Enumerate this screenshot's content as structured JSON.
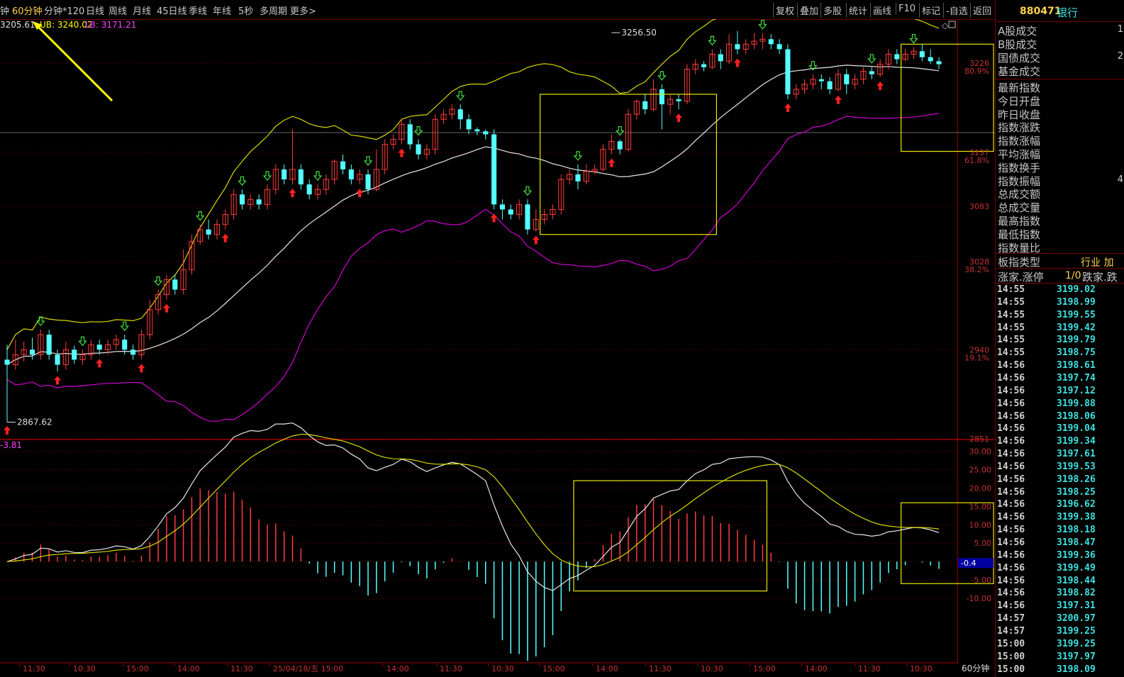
{
  "toolbar": {
    "periods": [
      "钟",
      "60分钟",
      "分钟*120",
      "日线",
      "周线",
      "月线",
      "45日线",
      "季线",
      "年线",
      "5秒",
      "多周期",
      "更多>"
    ],
    "active_index": 1,
    "right_buttons": [
      "复权",
      "叠加",
      "多股",
      "统计",
      "画线",
      "F10",
      "标记",
      "-自选",
      "返回"
    ]
  },
  "indicator": {
    "mid_text": "3205.61",
    "ub_text": "UB: 3240.02",
    "lb_text": "LB: 3171.21",
    "macd_text": "-3.81"
  },
  "main_axis": {
    "labels": [
      {
        "v": 3226,
        "t": "3226",
        "pct": "80.9%"
      },
      {
        "v": 3137,
        "t": "3137",
        "pct": "61.8%"
      },
      {
        "v": 3083,
        "t": "3083",
        "pct": ""
      },
      {
        "v": 3028,
        "t": "3028",
        "pct": "38.2%"
      },
      {
        "v": 2940,
        "t": "2940",
        "pct": "19.1%"
      },
      {
        "v": 2851,
        "t": "2851",
        "pct": ""
      }
    ],
    "annotations": [
      {
        "text": "2867.62",
        "v": 2867.62,
        "i": 0
      },
      {
        "text": "3256.50",
        "v": 3256.5,
        "i": 72
      }
    ]
  },
  "sub_axis": {
    "labels": [
      "30.00",
      "25.00",
      "20.00",
      "15.00",
      "10.00",
      "5.00",
      "-5.00",
      "-10.00"
    ],
    "current": "-0.4"
  },
  "x_axis": {
    "labels": [
      "11:30",
      "10:30",
      "15:00",
      "14:00",
      "11:30",
      "25/04/18/五 15:00",
      "14:00",
      "11:30",
      "10:30",
      "15:00",
      "14:00",
      "11:30",
      "10:30",
      "15:00",
      "14:00",
      "11:30",
      "10:30"
    ],
    "period": "60分钟"
  },
  "chart_data": {
    "type": "candlestick",
    "ylim": [
      2851,
      3270
    ],
    "subplot": {
      "type": "macd",
      "ylim": [
        -26,
        33
      ]
    },
    "candles": [
      [
        2930,
        2925,
        2945,
        2868
      ],
      [
        2925,
        2935,
        2950,
        2920
      ],
      [
        2935,
        2940,
        2948,
        2928
      ],
      [
        2940,
        2935,
        2952,
        2930
      ],
      [
        2935,
        2955,
        2960,
        2930
      ],
      [
        2955,
        2935,
        2960,
        2930
      ],
      [
        2935,
        2925,
        2940,
        2918
      ],
      [
        2925,
        2940,
        2948,
        2920
      ],
      [
        2940,
        2930,
        2944,
        2926
      ],
      [
        2930,
        2935,
        2940,
        2925
      ],
      [
        2935,
        2945,
        2950,
        2930
      ],
      [
        2945,
        2940,
        2950,
        2935
      ],
      [
        2940,
        2945,
        2950,
        2935
      ],
      [
        2945,
        2950,
        2955,
        2940
      ],
      [
        2950,
        2940,
        2955,
        2935
      ],
      [
        2940,
        2935,
        2945,
        2930
      ],
      [
        2935,
        2955,
        2960,
        2930
      ],
      [
        2955,
        2980,
        2990,
        2950
      ],
      [
        2980,
        2995,
        3000,
        2975
      ],
      [
        2995,
        3010,
        3015,
        2990
      ],
      [
        3010,
        3000,
        3015,
        2995
      ],
      [
        3000,
        3020,
        3040,
        2995
      ],
      [
        3020,
        3048,
        3055,
        3015
      ],
      [
        3048,
        3060,
        3065,
        3045
      ],
      [
        3060,
        3055,
        3070,
        3050
      ],
      [
        3055,
        3065,
        3070,
        3050
      ],
      [
        3065,
        3075,
        3080,
        3060
      ],
      [
        3075,
        3095,
        3100,
        3070
      ],
      [
        3095,
        3085,
        3100,
        3080
      ],
      [
        3085,
        3090,
        3095,
        3080
      ],
      [
        3090,
        3085,
        3095,
        3080
      ],
      [
        3085,
        3100,
        3105,
        3080
      ],
      [
        3100,
        3120,
        3125,
        3095
      ],
      [
        3120,
        3110,
        3125,
        3105
      ],
      [
        3110,
        3120,
        3160,
        3105
      ],
      [
        3120,
        3105,
        3125,
        3100
      ],
      [
        3105,
        3095,
        3110,
        3090
      ],
      [
        3095,
        3100,
        3105,
        3090
      ],
      [
        3100,
        3110,
        3115,
        3095
      ],
      [
        3110,
        3128,
        3130,
        3105
      ],
      [
        3128,
        3120,
        3135,
        3115
      ],
      [
        3120,
        3110,
        3125,
        3105
      ],
      [
        3110,
        3115,
        3120,
        3105
      ],
      [
        3115,
        3100,
        3120,
        3095
      ],
      [
        3100,
        3120,
        3140,
        3098
      ],
      [
        3120,
        3145,
        3150,
        3115
      ],
      [
        3145,
        3150,
        3155,
        3140
      ],
      [
        3150,
        3165,
        3170,
        3145
      ],
      [
        3165,
        3145,
        3170,
        3140
      ],
      [
        3145,
        3135,
        3150,
        3130
      ],
      [
        3135,
        3140,
        3145,
        3130
      ],
      [
        3140,
        3170,
        3175,
        3135
      ],
      [
        3170,
        3175,
        3180,
        3165
      ],
      [
        3175,
        3180,
        3185,
        3170
      ],
      [
        3180,
        3170,
        3185,
        3160
      ],
      [
        3170,
        3160,
        3175,
        3155
      ],
      [
        3160,
        3158,
        3162,
        3154
      ],
      [
        3158,
        3155,
        3160,
        3150
      ],
      [
        3155,
        3085,
        3160,
        3080
      ],
      [
        3085,
        3080,
        3090,
        3070
      ],
      [
        3080,
        3075,
        3085,
        3070
      ],
      [
        3075,
        3085,
        3090,
        3070
      ],
      [
        3085,
        3060,
        3090,
        3055
      ],
      [
        3060,
        3070,
        3080,
        3058
      ],
      [
        3070,
        3075,
        3080,
        3065
      ],
      [
        3075,
        3080,
        3085,
        3070
      ],
      [
        3080,
        3110,
        3115,
        3075
      ],
      [
        3110,
        3115,
        3120,
        3105
      ],
      [
        3115,
        3108,
        3125,
        3100
      ],
      [
        3108,
        3118,
        3125,
        3105
      ],
      [
        3118,
        3120,
        3125,
        3115
      ],
      [
        3120,
        3140,
        3145,
        3118
      ],
      [
        3140,
        3148,
        3155,
        3135
      ],
      [
        3148,
        3140,
        3150,
        3135
      ],
      [
        3140,
        3175,
        3180,
        3138
      ],
      [
        3175,
        3188,
        3190,
        3170
      ],
      [
        3188,
        3180,
        3195,
        3175
      ],
      [
        3180,
        3200,
        3210,
        3178
      ],
      [
        3200,
        3185,
        3205,
        3160
      ],
      [
        3185,
        3190,
        3195,
        3175
      ],
      [
        3190,
        3188,
        3195,
        3180
      ],
      [
        3188,
        3220,
        3225,
        3185
      ],
      [
        3220,
        3225,
        3230,
        3215
      ],
      [
        3225,
        3222,
        3228,
        3218
      ],
      [
        3222,
        3235,
        3240,
        3220
      ],
      [
        3235,
        3228,
        3240,
        3220
      ],
      [
        3228,
        3245,
        3255,
        3225
      ],
      [
        3245,
        3240,
        3258,
        3235
      ],
      [
        3240,
        3245,
        3250,
        3235
      ],
      [
        3245,
        3248,
        3256,
        3240
      ],
      [
        3248,
        3250,
        3256,
        3240
      ],
      [
        3250,
        3245,
        3255,
        3240
      ],
      [
        3245,
        3240,
        3250,
        3235
      ],
      [
        3240,
        3195,
        3245,
        3190
      ],
      [
        3195,
        3200,
        3205,
        3190
      ],
      [
        3200,
        3205,
        3210,
        3195
      ],
      [
        3205,
        3210,
        3215,
        3200
      ],
      [
        3210,
        3208,
        3215,
        3200
      ],
      [
        3208,
        3200,
        3212,
        3195
      ],
      [
        3200,
        3215,
        3220,
        3198
      ],
      [
        3215,
        3205,
        3220,
        3195
      ],
      [
        3205,
        3210,
        3215,
        3200
      ],
      [
        3210,
        3218,
        3222,
        3205
      ],
      [
        3218,
        3215,
        3222,
        3210
      ],
      [
        3215,
        3225,
        3230,
        3212
      ],
      [
        3225,
        3235,
        3240,
        3220
      ],
      [
        3235,
        3230,
        3240,
        3225
      ],
      [
        3230,
        3235,
        3240,
        3228
      ],
      [
        3235,
        3238,
        3242,
        3230
      ],
      [
        3238,
        3232,
        3245,
        3228
      ],
      [
        3232,
        3228,
        3240,
        3225
      ],
      [
        3228,
        3225,
        3232,
        3220
      ]
    ],
    "up_markers": [
      0,
      6,
      11,
      16,
      19,
      26,
      34,
      42,
      47,
      58,
      63,
      72,
      80,
      87,
      93,
      99,
      104
    ],
    "down_markers": [
      4,
      9,
      14,
      18,
      23,
      28,
      31,
      37,
      43,
      49,
      54,
      62,
      68,
      73,
      78,
      84,
      90,
      96,
      103,
      108
    ],
    "boxes_main": [
      [
        64,
        84,
        3055,
        3195
      ],
      [
        107,
        117,
        3138,
        3245
      ]
    ],
    "boxes_sub": [
      [
        68,
        90,
        -8,
        22
      ],
      [
        107,
        117,
        -6,
        16
      ]
    ]
  },
  "right_panel": {
    "code": "880471",
    "name": "银行",
    "stats_a": [
      {
        "l": "A股成交",
        "v": "1"
      },
      {
        "l": "B股成交",
        "v": ""
      },
      {
        "l": "国债成交",
        "v": "2"
      },
      {
        "l": "基金成交",
        "v": ""
      }
    ],
    "stats_b": [
      {
        "l": "最新指数",
        "v": ""
      },
      {
        "l": "今日开盘",
        "v": ""
      },
      {
        "l": "昨日收盘",
        "v": ""
      },
      {
        "l": "指数涨跌",
        "v": ""
      },
      {
        "l": "指数涨幅",
        "v": ""
      },
      {
        "l": "平均涨幅",
        "v": ""
      },
      {
        "l": "指数换手",
        "v": ""
      },
      {
        "l": "指数振幅",
        "v": "4"
      },
      {
        "l": "总成交额",
        "v": ""
      },
      {
        "l": "总成交量",
        "v": ""
      },
      {
        "l": "最高指数",
        "v": ""
      },
      {
        "l": "最低指数",
        "v": ""
      },
      {
        "l": "指数量比",
        "v": ""
      }
    ],
    "board_type_label": "板指类型",
    "board_type_value": "行业 加",
    "zhangjia_label": "涨家.涨停",
    "zhangjia_value": "1/0",
    "diejia_label": "跌家.跌",
    "ticks": [
      [
        "14:55",
        "3199.02"
      ],
      [
        "14:55",
        "3198.99"
      ],
      [
        "14:55",
        "3199.55"
      ],
      [
        "14:55",
        "3199.42"
      ],
      [
        "14:55",
        "3199.79"
      ],
      [
        "14:55",
        "3198.75"
      ],
      [
        "14:56",
        "3198.61"
      ],
      [
        "14:56",
        "3197.74"
      ],
      [
        "14:56",
        "3197.12"
      ],
      [
        "14:56",
        "3199.88"
      ],
      [
        "14:56",
        "3198.06"
      ],
      [
        "14:56",
        "3199.04"
      ],
      [
        "14:56",
        "3199.34"
      ],
      [
        "14:56",
        "3197.61"
      ],
      [
        "14:56",
        "3199.53"
      ],
      [
        "14:56",
        "3198.26"
      ],
      [
        "14:56",
        "3198.25"
      ],
      [
        "14:56",
        "3196.62"
      ],
      [
        "14:56",
        "3199.38"
      ],
      [
        "14:56",
        "3198.18"
      ],
      [
        "14:56",
        "3198.47"
      ],
      [
        "14:56",
        "3199.36"
      ],
      [
        "14:56",
        "3199.49"
      ],
      [
        "14:56",
        "3198.44"
      ],
      [
        "14:56",
        "3198.82"
      ],
      [
        "14:56",
        "3197.31"
      ],
      [
        "14:57",
        "3200.97"
      ],
      [
        "14:57",
        "3199.25"
      ],
      [
        "15:00",
        "3199.25"
      ],
      [
        "15:00",
        "3197.97"
      ],
      [
        "15:00",
        "3198.09"
      ]
    ]
  }
}
